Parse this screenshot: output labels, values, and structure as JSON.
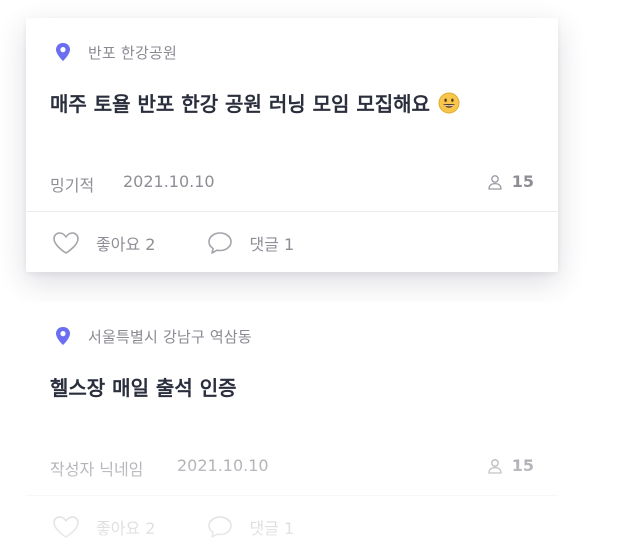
{
  "posts": [
    {
      "location": "반포 한강공원",
      "title": "매주 토욜 반포 한강 공원 러닝 모임 모집해요",
      "title_emoji": "grinning-face-emoji",
      "author": "밍기적",
      "date": "2021.10.10",
      "members": "15",
      "like_label": "좋아요 2",
      "comment_label": "댓글 1"
    },
    {
      "location": "서울특별시 강남구 역삼동",
      "title": "헬스장 매일 출석 인증",
      "author": "작성자 닉네임",
      "date": "2021.10.10",
      "members": "15",
      "like_label": "좋아요 2",
      "comment_label": "댓글 1"
    }
  ],
  "icons": {
    "location": "map-pin-icon",
    "members": "person-icon",
    "like": "heart-icon",
    "comment": "speech-bubble-icon"
  },
  "colors": {
    "pin": "#6b6ef0",
    "title": "#2b2f3d",
    "muted": "#8e8e96",
    "divider": "#ececef"
  }
}
